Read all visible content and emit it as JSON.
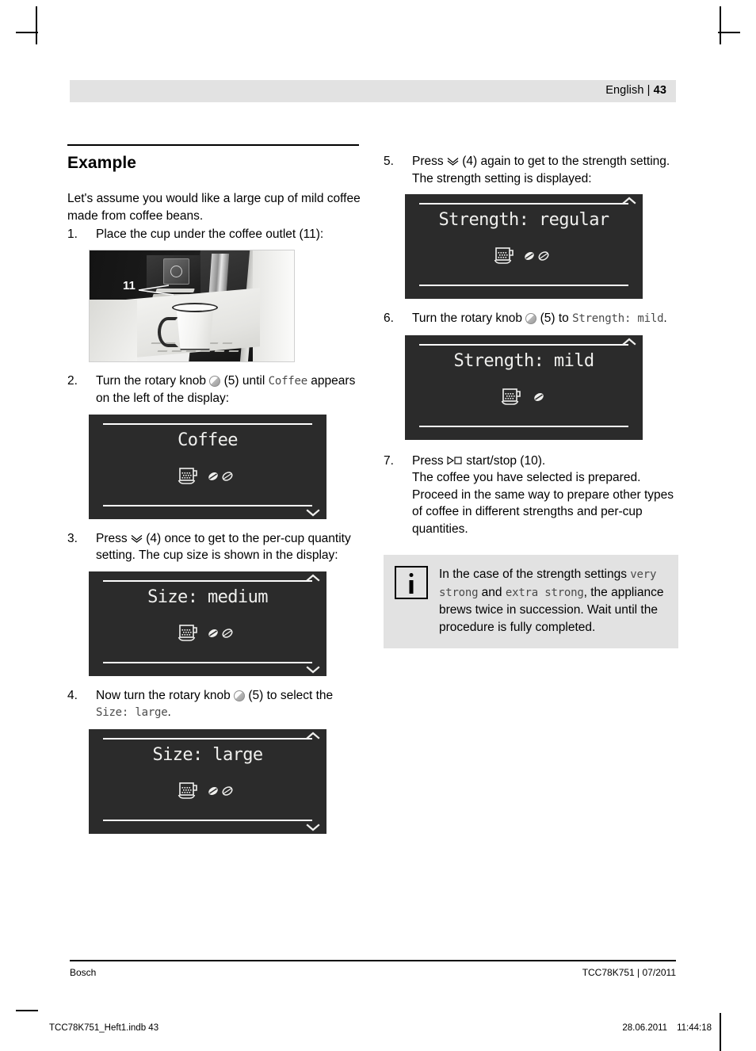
{
  "page": {
    "header_language": "English",
    "header_separator": "|",
    "header_page_number": "43",
    "section_title": "Example",
    "intro": "Let's assume you would like a large cup of mild coffee made from coffee beans.",
    "footer_brand": "Bosch",
    "footer_doc": "TCC78K751 | 07/2011",
    "meta_file": "TCC78K751_Heft1.indb   43",
    "meta_date": "28.06.2011",
    "meta_time": "11:44:18"
  },
  "steps": {
    "s1": {
      "num": "1.",
      "text_before": "Place the cup under the coffee outlet (11):",
      "photo_callout": "11"
    },
    "s2": {
      "num": "2.",
      "a": "Turn the rotary knob ",
      "b": " (5) until ",
      "lcd_word": "Coffee",
      "c": " appears on the left of the display:"
    },
    "s3": {
      "num": "3.",
      "a": "Press ",
      "b": " (4) once to get to the per-cup quantity setting. The cup size is shown in the display:"
    },
    "s4": {
      "num": "4.",
      "a": "Now turn the rotary knob ",
      "b": " (5) to select the ",
      "lcd_word": "Size: large",
      "c": "."
    },
    "s5": {
      "num": "5.",
      "a": "Press ",
      "b": " (4) again to get to the strength setting. The strength setting is displayed:"
    },
    "s6": {
      "num": "6.",
      "a": "Turn the rotary knob ",
      "b": " (5) to ",
      "lcd_word": "Strength: mild",
      "c": "."
    },
    "s7": {
      "num": "7.",
      "a": "Press ",
      "b": " start/stop (10).",
      "c": "The coffee you have selected is prepared. Proceed in the same way to prepare other types of coffee in different strengths and per-cup quantities."
    }
  },
  "displays": {
    "coffee": {
      "title": "Coffee",
      "cup": true,
      "beans": 2,
      "filled_beans": 1,
      "chev_up": false,
      "chev_down": true
    },
    "size_medium": {
      "title": "Size: medium",
      "cup": true,
      "beans": 2,
      "filled_beans": 1,
      "chev_up": true,
      "chev_down": true
    },
    "size_large": {
      "title": "Size: large",
      "cup": true,
      "beans": 2,
      "filled_beans": 1,
      "chev_up": true,
      "chev_down": true
    },
    "strength_regular": {
      "title": "Strength: regular",
      "cup": true,
      "beans": 2,
      "filled_beans": 1,
      "chev_up": true,
      "chev_down": false
    },
    "strength_mild": {
      "title": "Strength: mild",
      "cup": true,
      "beans": 1,
      "filled_beans": 1,
      "chev_up": true,
      "chev_down": false
    }
  },
  "note": {
    "a": "In the case of the strength settings ",
    "lcd_1": "very strong",
    "b": " and ",
    "lcd_2": "extra strong",
    "c": ", the appliance brews twice in succession. Wait until the procedure is fully completed."
  },
  "icons": {
    "rotary_knob": "rotary-knob-icon",
    "double_chevron_down": "double-chevron-down-icon",
    "start_stop": "start-stop-icon",
    "info": "info-icon",
    "chevron_up": "chevron-up-icon",
    "chevron_down": "chevron-down-icon",
    "cup": "coffee-cup-icon",
    "bean": "coffee-bean-icon"
  },
  "colors": {
    "lcd_background": "#2b2b2b",
    "lcd_foreground": "#f0f0ee",
    "band_gray": "#e2e2e2",
    "page_background": "#ffffff"
  }
}
